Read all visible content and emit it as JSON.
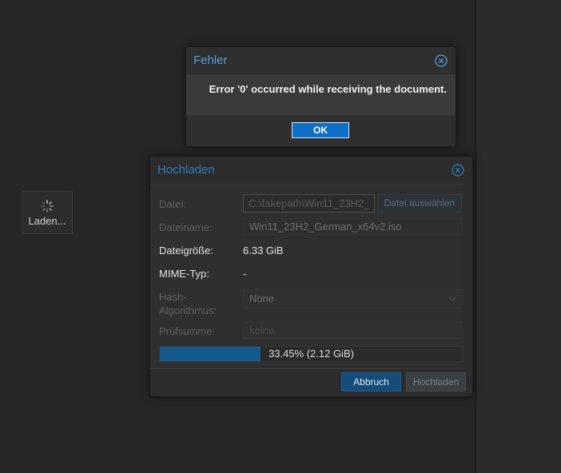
{
  "loading": {
    "label": "Laden..."
  },
  "error_dialog": {
    "title": "Fehler",
    "message": "Error '0' occurred while receiving the document.",
    "ok_label": "OK"
  },
  "upload_dialog": {
    "title": "Hochladen",
    "file": {
      "label": "Datei:",
      "value": "C:\\fakepath\\Win11_23H2_",
      "button_label": "Datei auswählen"
    },
    "filename": {
      "label": "Dateiname:",
      "value": "Win11_23H2_German_x64v2.iso"
    },
    "filesize": {
      "label": "Dateigröße:",
      "value": "6.33 GiB"
    },
    "mime": {
      "label": "MIME-Typ:",
      "value": "-"
    },
    "hash": {
      "label_line1": "Hash-",
      "label_line2": "Algorithmus:",
      "value": "None"
    },
    "checksum": {
      "label": "Prüfsumme:",
      "placeholder": "keine"
    },
    "progress": {
      "fraction": 0.3345,
      "text": "33.45% (2.12 GiB)"
    },
    "abort_label": "Abbruch",
    "upload_label": "Hochladen"
  },
  "colors": {
    "accent": "#0f6fc6",
    "title": "#4f9fdc",
    "progress": "#145a8d"
  }
}
